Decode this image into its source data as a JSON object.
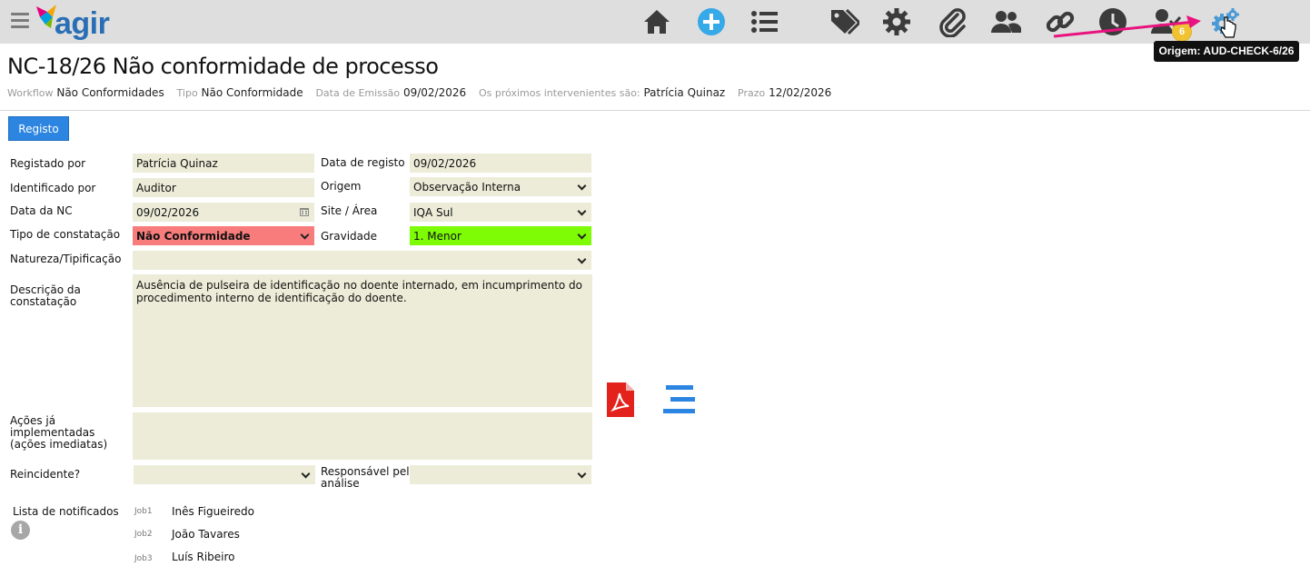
{
  "app": {
    "name": "agir"
  },
  "toolbar": {
    "icons": [
      "home-icon",
      "add-circle-icon",
      "list-icon",
      "tags-icon",
      "gear-icon",
      "paperclip-icon",
      "users-icon",
      "link-icon",
      "clock-icon",
      "user-check-icon",
      "gears-icon"
    ],
    "badge_count": "6",
    "tooltip": "Origem: AUD-CHECK-6/26",
    "icon_color": "#3b3b3b",
    "active_icon_color": "#4a9ad6"
  },
  "header": {
    "title": "NC-18/26 Não conformidade de processo",
    "meta": [
      {
        "key": "Workflow",
        "value": "Não Conformidades"
      },
      {
        "key": "Tipo",
        "value": "Não Conformidade"
      },
      {
        "key": "Data de Emissão",
        "value": "09/02/2026"
      },
      {
        "key": "Os próximos intervenientes são:",
        "value": "Patrícia Quinaz"
      },
      {
        "key": "Prazo",
        "value": "12/02/2026"
      }
    ]
  },
  "tabs": {
    "registo": "Registo"
  },
  "form": {
    "registado_por": {
      "label": "Registado por",
      "value": "Patrícia Quinaz"
    },
    "data_registo": {
      "label": "Data de registo",
      "value": "09/02/2026"
    },
    "identificado_por": {
      "label": "Identificado por",
      "value": "Auditor"
    },
    "origem": {
      "label": "Origem",
      "value": "Observação Interna"
    },
    "data_nc": {
      "label": "Data da NC",
      "value": "09/02/2026"
    },
    "site_area": {
      "label": "Site / Área",
      "value": "IQA Sul"
    },
    "tipo_constatacao": {
      "label": "Tipo de constatação",
      "value": "Não Conformidade",
      "color": "#f87c7c"
    },
    "gravidade": {
      "label": "Gravidade",
      "value": "1. Menor",
      "color": "#7dfc05"
    },
    "natureza": {
      "label": "Natureza/Tipificação",
      "value": ""
    },
    "descricao": {
      "label": "Descrição da\nconstatação",
      "value": "Ausência de pulseira de identificação no doente internado, em incumprimento do\nprocedimento interno de identificação do doente."
    },
    "acoes": {
      "label": "Ações já\nimplementadas\n(ações imediatas)",
      "value": ""
    },
    "reincidente": {
      "label": "Reincidente?",
      "value": ""
    },
    "responsavel": {
      "label": "Responsável pela\nanálise",
      "value": ""
    }
  },
  "notificados": {
    "label": "Lista de notificados",
    "items": [
      {
        "job": "Job1",
        "name": "Inês Figueiredo"
      },
      {
        "job": "Job2",
        "name": "João Tavares"
      },
      {
        "job": "Job3",
        "name": "Luís Ribeiro"
      }
    ]
  }
}
